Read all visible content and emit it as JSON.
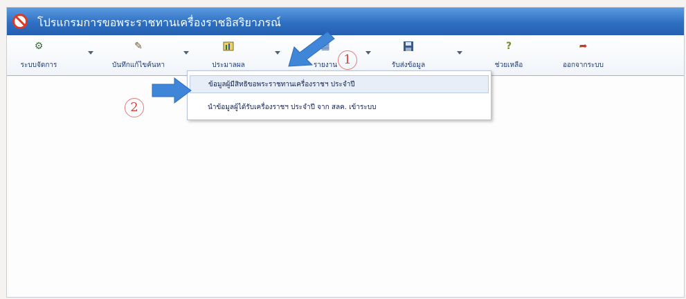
{
  "window": {
    "title": "โปรแกรมการขอพระราชทานเครื่องราชอิสริยาภรณ์"
  },
  "toolbar": {
    "items": [
      {
        "label": "ระบบจัดการ",
        "icon": "settings-icon"
      },
      {
        "label": "บันทึกแก้ไขค้นหา",
        "icon": "edit-icon"
      },
      {
        "label": "ประมาลผล",
        "icon": "process-icon"
      },
      {
        "label": "รายงาน",
        "icon": "report-icon"
      },
      {
        "label": "รับส่งข้อมูล",
        "icon": "save-icon"
      },
      {
        "label": "ช่วยเหลือ",
        "icon": "help-icon"
      },
      {
        "label": "ออกจากระบบ",
        "icon": "logout-icon"
      }
    ]
  },
  "dropdown": {
    "items": [
      {
        "label": "ข้อมูลผู้มีสิทธิขอพระราชทานเครื่องราชฯ ประจำปี"
      },
      {
        "label": "นำข้อมูลผู้ได้รับเครื่องราชฯ ประจำปี จาก สลค. เข้าระบบ"
      }
    ]
  },
  "annotations": {
    "step1": "1",
    "step2": "2"
  },
  "colors": {
    "titlebar": "#2f6fc2",
    "arrow": "#3f86d8",
    "step_marker": "#d9413c"
  }
}
